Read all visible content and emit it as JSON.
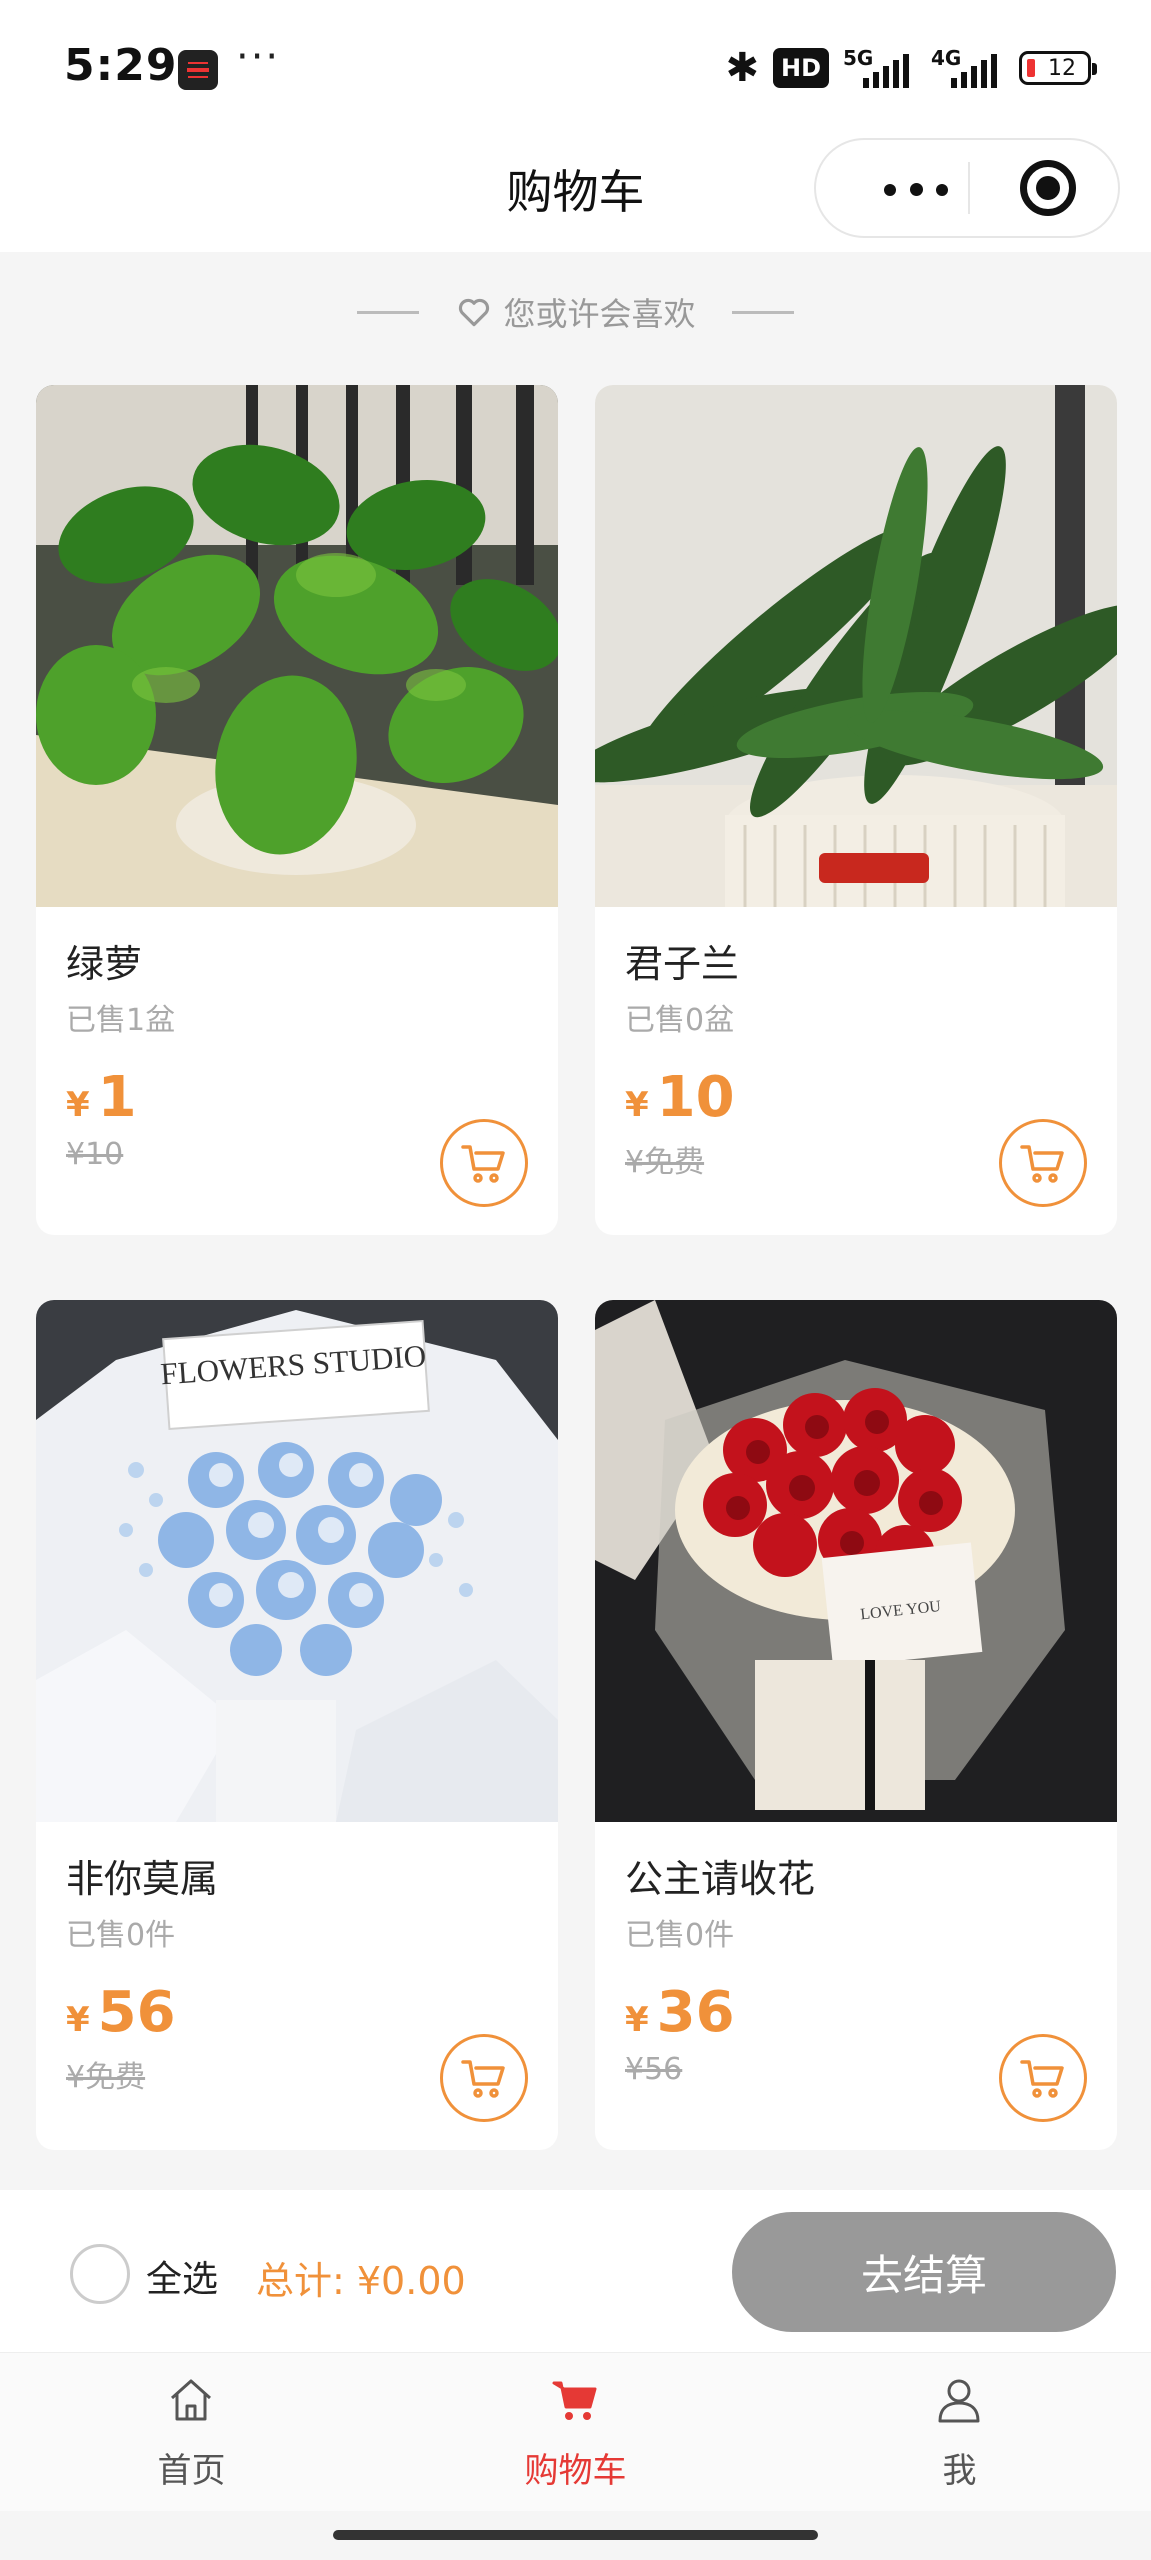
{
  "status_bar": {
    "time": "5:29",
    "dots": "···",
    "hd": "HD",
    "signal1": "5G",
    "signal2": "4G",
    "battery": "12"
  },
  "header": {
    "title": "购物车"
  },
  "recommend": {
    "title": "您或许会喜欢"
  },
  "products": [
    {
      "name": "绿萝",
      "sold": "已售1盆",
      "currency": "¥",
      "price": "1",
      "original": "¥10"
    },
    {
      "name": "君子兰",
      "sold": "已售0盆",
      "currency": "¥",
      "price": "10",
      "original": "¥免费"
    },
    {
      "name": "非你莫属",
      "sold": "已售0件",
      "currency": "¥",
      "price": "56",
      "original": "¥免费"
    },
    {
      "name": "公主请收花",
      "sold": "已售0件",
      "currency": "¥",
      "price": "36",
      "original": "¥56"
    }
  ],
  "image_text": {
    "studio_card": "FLOWERS STUDIO",
    "love_card": "LOVE YOU"
  },
  "checkout": {
    "select_all": "全选",
    "total": "总计: ¥0.00",
    "button": "去结算"
  },
  "tabbar": {
    "items": [
      {
        "label": "首页"
      },
      {
        "label": "购物车"
      },
      {
        "label": "我"
      }
    ]
  },
  "colors": {
    "accent": "#f0913a",
    "active_tab": "#e53935",
    "checkout_disabled": "#999999"
  }
}
